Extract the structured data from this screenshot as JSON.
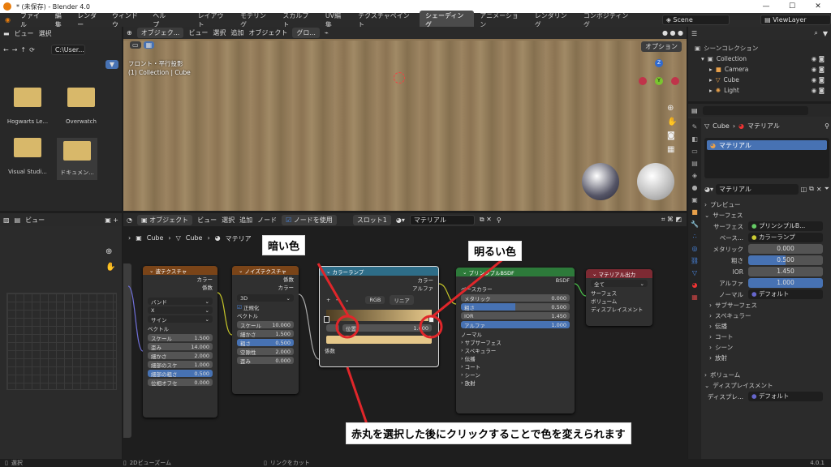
{
  "title": "* (未保存) - Blender 4.0",
  "window_buttons": [
    "—",
    "☐",
    "✕"
  ],
  "menu": [
    "ファイル",
    "編集",
    "レンダー",
    "ウィンドウ",
    "ヘルプ"
  ],
  "workspaces": [
    "レイアウト",
    "モデリング",
    "スカルプト",
    "UV編集",
    "テクスチャペイント",
    "シェーディング",
    "アニメーション",
    "レンダリング",
    "コンポジティング"
  ],
  "scene": "Scene",
  "view_layer": "ViewLayer",
  "file_browser": {
    "menu": [
      "ビュー",
      "選択"
    ],
    "path": "C:\\User...",
    "items": [
      "Hogwarts Le...",
      "Overwatch",
      "Visual Studi...",
      "ドキュメン..."
    ]
  },
  "viewport": {
    "object_mode": "オブジェク...",
    "menu": [
      "ビュー",
      "選択",
      "追加",
      "オブジェクト"
    ],
    "transform": "グロ...",
    "view_name": "フロント・平行投影",
    "collection_info": "(1) Collection | Cube",
    "options": "オプション"
  },
  "outliner": {
    "root": "シーンコレクション",
    "collection": "Collection",
    "items": [
      "Camera",
      "Cube",
      "Light"
    ]
  },
  "properties": {
    "object": "Cube",
    "material_tab": "マテリアル",
    "slot": "マテリアル",
    "material_name": "マテリアル",
    "sections": {
      "preview": "プレビュー",
      "surface": "サーフェス"
    },
    "surface_label": "サーフェス",
    "surface_value": "プリンシプルB...",
    "rows": [
      {
        "label": "ベース...",
        "value": "カラーランプ"
      },
      {
        "label": "メタリック",
        "value": "0.000"
      },
      {
        "label": "粗さ",
        "value": "0.500"
      },
      {
        "label": "IOR",
        "value": "1.450"
      },
      {
        "label": "アルファ",
        "value": "1.000"
      },
      {
        "label": "ノーマル",
        "value": "デフォルト"
      }
    ],
    "subsections": [
      "サブサーフェス",
      "スペキュラー",
      "伝播",
      "コート",
      "シーン",
      "放射"
    ],
    "volume": "ボリューム",
    "displacement": "ディスプレイスメント",
    "disp_label": "ディスプレ...",
    "disp_value": "デフォルト",
    "version": "4.0.1"
  },
  "image_editor": {
    "menu": "ビュー"
  },
  "node_editor": {
    "mode": "オブジェクト",
    "menu": [
      "ビュー",
      "選択",
      "追加",
      "ノード"
    ],
    "use_nodes": "ノードを使用",
    "slot": "スロット1",
    "material": "マテリアル",
    "breadcrumb": [
      "Cube",
      "Cube",
      "マテリア"
    ]
  },
  "nodes": {
    "wave": {
      "title": "波テクスチャ",
      "outputs": [
        "カラー",
        "係数"
      ],
      "dropdowns": [
        "バンド",
        "X",
        "サイン"
      ],
      "vector": "ベクトル",
      "fields": [
        {
          "l": "スケール",
          "v": "1.500"
        },
        {
          "l": "歪み",
          "v": "14.000"
        },
        {
          "l": "細かさ",
          "v": "2.000"
        },
        {
          "l": "細部のスケ",
          "v": "1.000"
        },
        {
          "l": "細部の粗さ",
          "v": "0.500"
        },
        {
          "l": "位相オフセ",
          "v": "0.000"
        }
      ]
    },
    "noise": {
      "title": "ノイズテクスチャ",
      "outputs": [
        "係数",
        "カラー"
      ],
      "dim": "3D",
      "normalize": "正規化",
      "vector": "ベクトル",
      "fields": [
        {
          "l": "スケール",
          "v": "10.000"
        },
        {
          "l": "細かさ",
          "v": "1.500"
        },
        {
          "l": "粗さ",
          "v": "0.500"
        },
        {
          "l": "空隙性",
          "v": "2.000"
        },
        {
          "l": "歪み",
          "v": "0.000"
        }
      ]
    },
    "ramp": {
      "title": "カラーランプ",
      "outputs": [
        "カラー",
        "アルファ"
      ],
      "color_mode": "RGB",
      "interp": "リニア",
      "pos_label": "位置",
      "pos_value": "1.000",
      "input": "係数"
    },
    "bsdf": {
      "title": "プリンシプルBSDF",
      "output": "BSDF",
      "base": "ベースカラー",
      "fields": [
        {
          "l": "メタリック",
          "v": "0.000"
        },
        {
          "l": "粗さ",
          "v": "0.500"
        },
        {
          "l": "IOR",
          "v": "1.450"
        },
        {
          "l": "アルファ",
          "v": "1.000"
        }
      ],
      "normal": "ノーマル",
      "subs": [
        "サブサーフェス",
        "スペキュラー",
        "伝播",
        "コート",
        "シーン",
        "放射"
      ]
    },
    "output": {
      "title": "マテリアル出力",
      "target": "全て",
      "inputs": [
        "サーフェス",
        "ボリューム",
        "ディスプレイスメント"
      ]
    }
  },
  "annotations": {
    "dark": "暗い色",
    "light": "明るい色",
    "instruction": "赤丸を選択した後にクリックすることで色を変えられます"
  },
  "status": {
    "left": "選択",
    "mid": "2Dビューズーム",
    "right": "リンクをカット"
  },
  "colors": {
    "accent": "#4772b3",
    "red": "#e0262a",
    "wave_header": "#7a4418",
    "ramp_header": "#2e6d88",
    "bsdf_header": "#2d7a3a",
    "output_header": "#7d2a33"
  }
}
